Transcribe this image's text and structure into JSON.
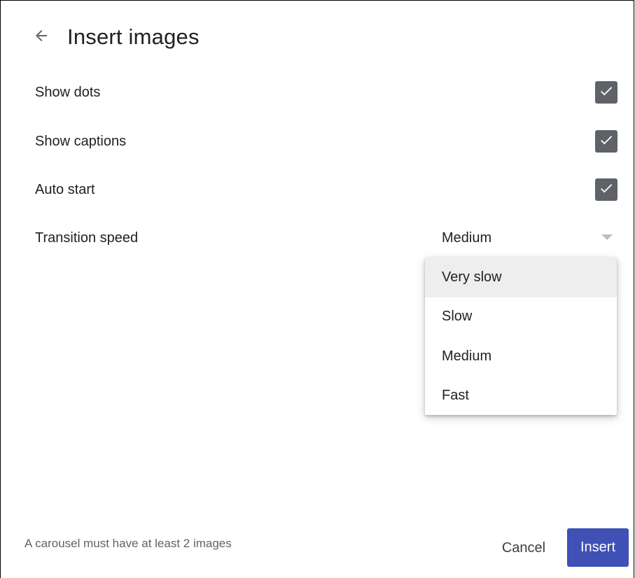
{
  "header": {
    "title": "Insert images"
  },
  "settings": {
    "show_dots": {
      "label": "Show dots",
      "checked": true
    },
    "show_captions": {
      "label": "Show captions",
      "checked": true
    },
    "auto_start": {
      "label": "Auto start",
      "checked": true
    },
    "transition_speed": {
      "label": "Transition speed",
      "value": "Medium"
    }
  },
  "dropdown": {
    "options": [
      "Very slow",
      "Slow",
      "Medium",
      "Fast"
    ],
    "highlighted": "Very slow"
  },
  "footer": {
    "note": "A carousel must have at least 2 images",
    "cancel_label": "Cancel",
    "insert_label": "Insert"
  },
  "colors": {
    "checkbox": "#5f6368",
    "primary_button": "#3f51b5",
    "highlight": "#eeeeee"
  },
  "icons": {
    "back": "arrow-left-icon",
    "check": "check-icon",
    "dropdown": "triangle-down-icon"
  }
}
